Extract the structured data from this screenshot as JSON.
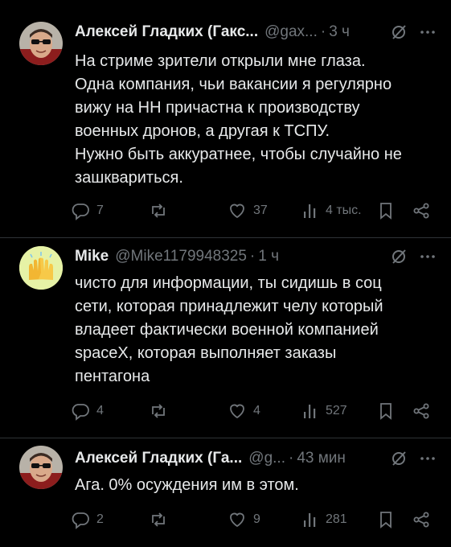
{
  "tweets": [
    {
      "author": "Алексей Гладких (Гакс...",
      "handle": "@gax...",
      "time": "3 ч",
      "lines": [
        "На стриме зрители открыли мне глаза.",
        "Одна компания, чьи вакансии я регулярно",
        "вижу на НН причастна к производству",
        "военных дронов, а другая к ТСПУ.",
        "Нужно быть аккуратнее, чтобы случайно не",
        "зашквариться."
      ],
      "replies": "7",
      "retweets": "",
      "likes": "37",
      "views": "4 тыс."
    },
    {
      "author": "Mike",
      "handle": "@Mike1179948325",
      "time": "1 ч",
      "lines": [
        "чисто для информации, ты сидишь в соц",
        "сети, которая принадлежит челу который",
        "владеет фактически военной компанией",
        "spaceX, которая выполняет заказы",
        "пентагона"
      ],
      "replies": "4",
      "retweets": "",
      "likes": "4",
      "views": "527"
    },
    {
      "author": "Алексей Гладких (Га...",
      "handle": "@g...",
      "time": "43 мин",
      "lines": [
        "Ага. 0% осуждения им в этом."
      ],
      "replies": "2",
      "retweets": "",
      "likes": "9",
      "views": "281"
    }
  ],
  "icons": {
    "reply": "reply-icon",
    "retweet": "retweet-icon",
    "like": "heart-icon",
    "views": "views-icon",
    "bookmark": "bookmark-icon",
    "share": "share-icon",
    "grok": "grok-icon",
    "more": "more-icon"
  },
  "colors": {
    "background": "#000000",
    "text": "#e7e9ea",
    "muted": "#71767b"
  }
}
